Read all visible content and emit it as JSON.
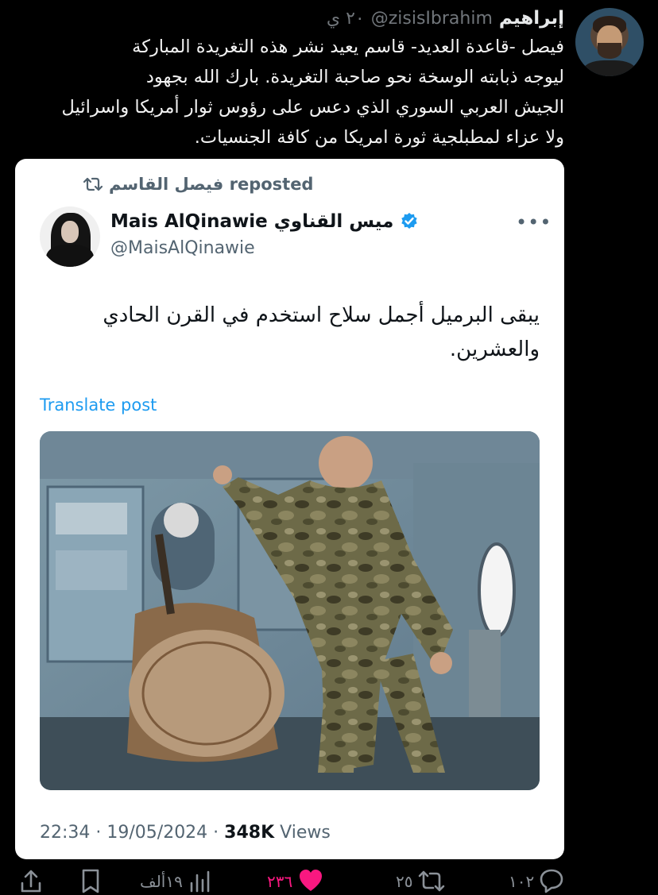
{
  "tweet": {
    "author_name": "إبراهيم",
    "author_handle": "@zisisIbrahim",
    "time": "٢٠ ي",
    "text_lines": [
      "فيصل -قاعدة العديد- قاسم يعيد نشر هذه التغريدة المباركة",
      "ليوجه ذبابته الوسخة نحو صاحبة التغريدة. بارك الله بجهود",
      "الجيش العربي السوري الذي دعس على رؤوس ثوار أمريكا واسرائيل",
      "ولا عزاء لمطبلجية ثورة امريكا من كافة الجنسيات."
    ]
  },
  "quoted": {
    "repost_text": "فيصل القاسم reposted",
    "name": "Mais AlQinawie ميس القناوي",
    "handle": "@MaisAlQinawie",
    "text_lines": [
      "يبقى البرميل أجمل سلاح استخدم في القرن الحادي",
      "والعشرين."
    ],
    "translate_label": "Translate post",
    "time": "22:34 · 19/05/2024 · ",
    "views_count": "348K",
    "views_label": " Views"
  },
  "actions": {
    "replies": "١٠٢",
    "reposts": "٢٥",
    "likes": "٢٣٦",
    "views": "١٩ألف"
  },
  "colors": {
    "background": "#000000",
    "link": "#1d9bf0",
    "like": "#f91880",
    "verified": "#1d9bf0"
  },
  "icons": [
    "repost-icon",
    "verified-badge-icon",
    "more-icon",
    "share-icon",
    "bookmark-icon",
    "views-icon",
    "heart-icon",
    "reply-icon"
  ]
}
